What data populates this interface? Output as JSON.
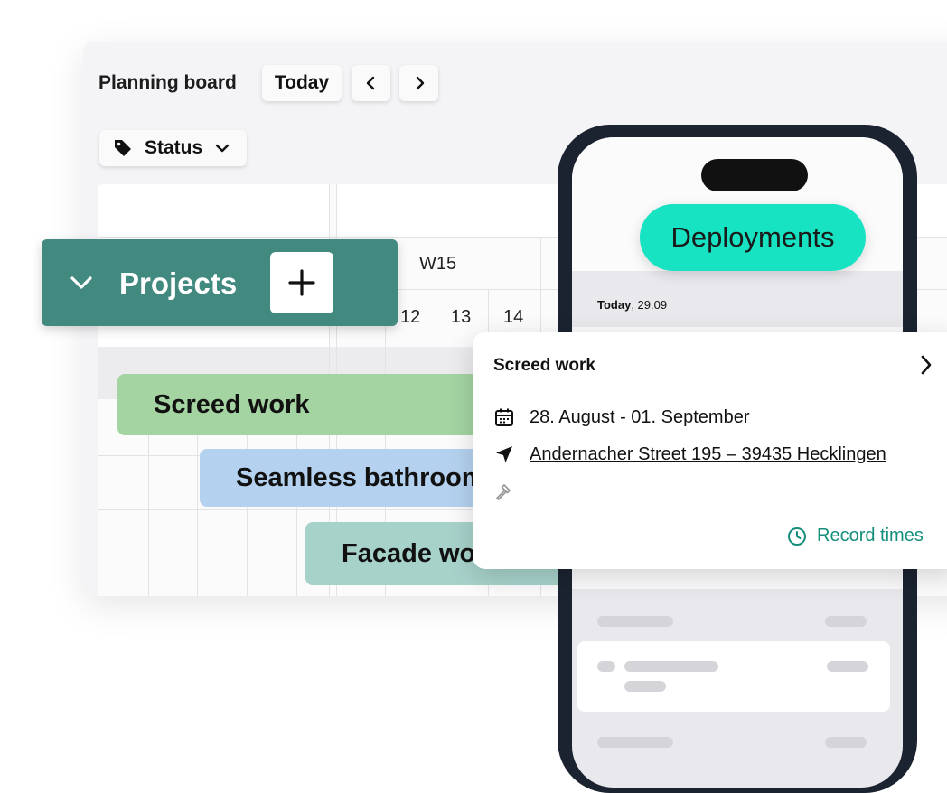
{
  "board": {
    "title": "Planning board",
    "today_label": "Today",
    "status_label": "Status",
    "week_label": "W15",
    "days": [
      "12",
      "13",
      "14"
    ]
  },
  "projects": {
    "label": "Projects"
  },
  "tasks": [
    {
      "label": "Screed work",
      "color": "#a4d4a2"
    },
    {
      "label": "Seamless bathroom",
      "color": "#b4d2ef"
    },
    {
      "label": "Facade work",
      "color": "#a7d2ca"
    }
  ],
  "phone": {
    "header_label": "Deployments",
    "date_today": "Today",
    "date_value": ", 29.09"
  },
  "popup": {
    "title": "Screed work",
    "date_range": "28. August - 01. September",
    "address": "Andernacher Street 195 – 39435 Hecklingen",
    "record_label": "Record times"
  },
  "colors": {
    "projects_bg": "#428a80",
    "deployments_bg": "#17e3c2",
    "accent_text": "#158f7c"
  }
}
